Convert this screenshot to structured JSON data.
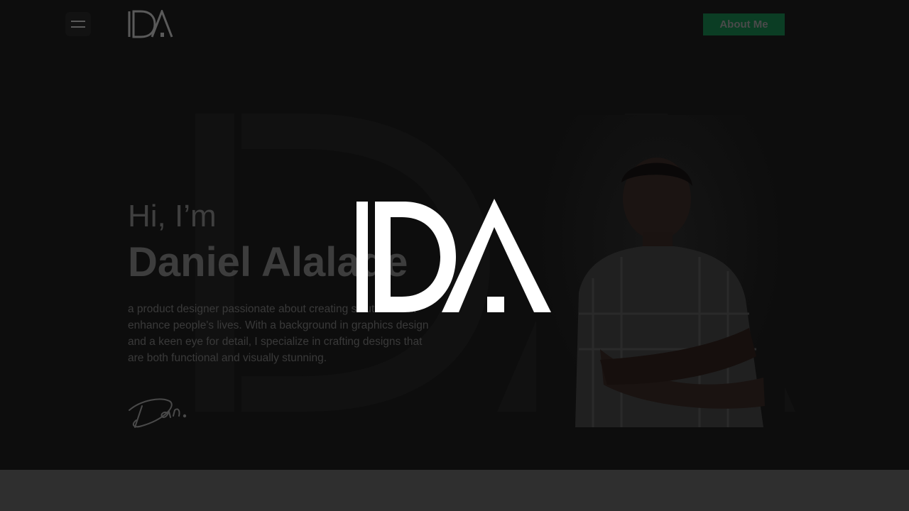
{
  "header": {
    "logo_icon": "da-monogram-logo",
    "menu_icon": "hamburger-menu-icon",
    "about_label": "About Me"
  },
  "hero": {
    "greeting": "Hi, I’m",
    "name": "Daniel Alalade",
    "bio": "a product designer passionate about creating solutions that enhance people's lives. With a background in graphics design and a keen eye for detail, I specialize in crafting designs that are both functional and visually stunning.",
    "signature": "Dan."
  },
  "loader": {
    "logo_icon": "da-monogram-logo-large"
  },
  "colors": {
    "background": "#0d0d0d",
    "accent": "#0b3d24",
    "footer": "#2f2f2f",
    "loader_logo": "#ffffff"
  }
}
